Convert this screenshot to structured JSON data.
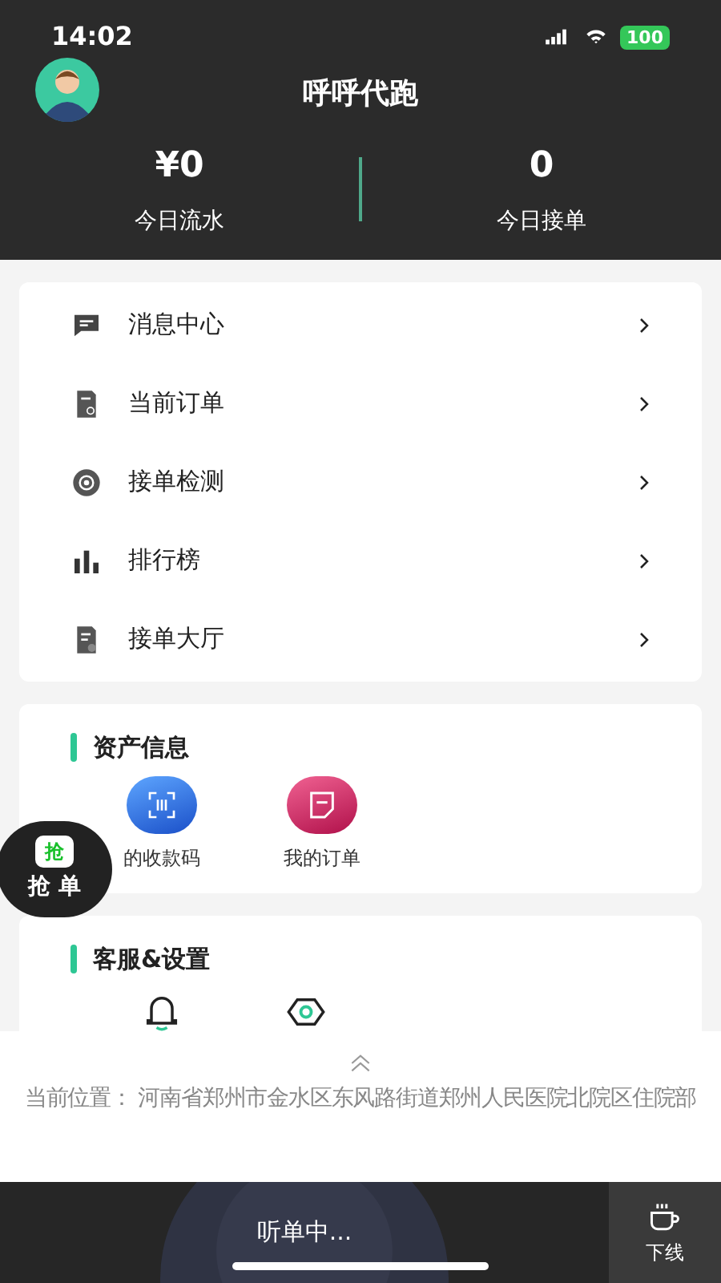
{
  "status_bar": {
    "time": "14:02",
    "battery": "100"
  },
  "header": {
    "title": "呼呼代跑"
  },
  "stats": [
    {
      "value": "¥0",
      "label": "今日流水"
    },
    {
      "value": "0",
      "label": "今日接单"
    }
  ],
  "menu": [
    {
      "kind": "message",
      "label": "消息中心"
    },
    {
      "kind": "order",
      "label": "当前订单"
    },
    {
      "kind": "check",
      "label": "接单检测"
    },
    {
      "kind": "rank",
      "label": "排行榜"
    },
    {
      "kind": "hall",
      "label": "接单大厅"
    }
  ],
  "assets": {
    "title": "资产信息",
    "items": [
      {
        "kind": "qr",
        "label": "的收款码"
      },
      {
        "kind": "orders",
        "label": "我的订单"
      }
    ]
  },
  "service": {
    "title": "客服&设置",
    "items": [
      {
        "kind": "bell"
      },
      {
        "kind": "gear"
      }
    ]
  },
  "grab_button": {
    "badge": "抢",
    "label": "抢 单"
  },
  "location": {
    "text": "当前位置： 河南省郑州市金水区东风路街道郑州人民医院北院区住院部"
  },
  "bottom_bar": {
    "status": "听单中...",
    "offline": "下线"
  }
}
